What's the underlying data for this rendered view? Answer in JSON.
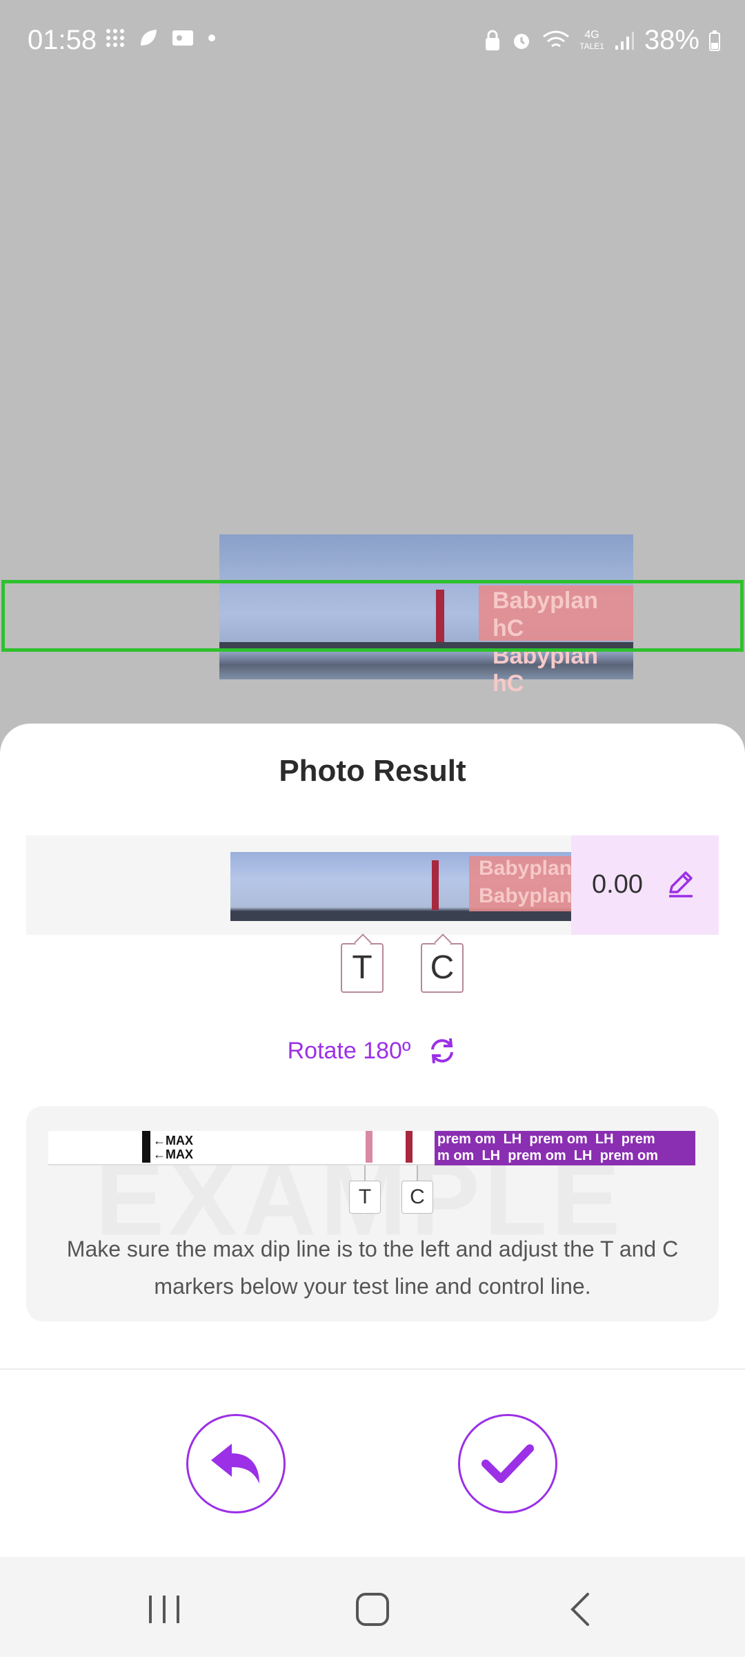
{
  "status_bar": {
    "time": "01:58",
    "battery": "38%",
    "network_label": "4G",
    "network_sub": "TALE1"
  },
  "photo": {
    "brand_line1": "Babyplan hC",
    "brand_line2": "Babyplan hC"
  },
  "sheet": {
    "title": "Photo Result",
    "result_value": "0.00",
    "marker_t": "T",
    "marker_c": "C",
    "result_brand_line1": "Babyplan",
    "result_brand_line2": "Babyplan",
    "rotate_label": "Rotate 180º",
    "example": {
      "watermark": "EXAMPLE",
      "max_line1": "←MAX",
      "max_line2": "←MAX",
      "brand_line1": "prem om  LH  prem om  LH  prem",
      "brand_line2": "m om  LH  prem om  LH  prem om",
      "marker_t": "T",
      "marker_c": "C",
      "caption": "Make sure the max dip line is to the left and adjust the T and C markers below your test line and control line."
    }
  },
  "colors": {
    "accent": "#9b30e6",
    "frame": "#2ec12e",
    "value_bg": "#f6e3fb"
  },
  "icons": {
    "edit": "pencil-icon",
    "rotate": "rotate-icon",
    "back": "undo-arrow-icon",
    "confirm": "checkmark-icon"
  }
}
